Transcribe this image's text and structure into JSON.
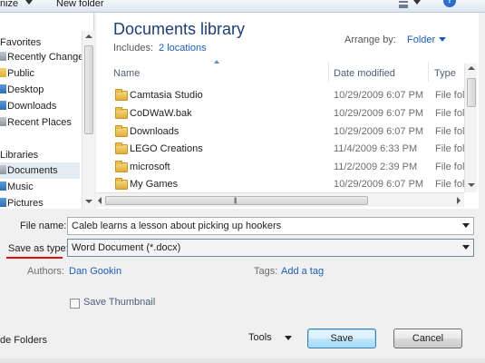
{
  "toolbar": {
    "organize_label": "nize",
    "new_folder_label": "New folder"
  },
  "nav": {
    "favorites_heading": "Favorites",
    "favorites": [
      {
        "label": "Recently Changed",
        "icon": "recent-places-icon"
      },
      {
        "label": "Public",
        "icon": "folder-icon"
      },
      {
        "label": "Desktop",
        "icon": "desktop-icon"
      },
      {
        "label": "Downloads",
        "icon": "downloads-icon"
      },
      {
        "label": "Recent Places",
        "icon": "recent-places-icon"
      }
    ],
    "libraries_heading": "Libraries",
    "libraries": [
      {
        "label": "Documents",
        "icon": "documents-icon",
        "selected": true
      },
      {
        "label": "Music",
        "icon": "music-icon"
      },
      {
        "label": "Pictures",
        "icon": "pictures-icon"
      }
    ]
  },
  "library": {
    "title": "Documents library",
    "includes_label": "Includes:",
    "includes_link": "2 locations",
    "arrange_label": "Arrange by:",
    "arrange_value": "Folder"
  },
  "columns": {
    "name": "Name",
    "date_modified": "Date modified",
    "type": "Type"
  },
  "files": [
    {
      "name": "Camtasia Studio",
      "date": "10/29/2009 6:07 PM",
      "type": "File fol"
    },
    {
      "name": "CoDWaW.bak",
      "date": "10/29/2009 6:07 PM",
      "type": "File fol"
    },
    {
      "name": "Downloads",
      "date": "10/29/2009 6:07 PM",
      "type": "File fol"
    },
    {
      "name": "LEGO Creations",
      "date": "11/4/2009 6:33 PM",
      "type": "File fol"
    },
    {
      "name": "microsoft",
      "date": "11/2/2009 2:39 PM",
      "type": "File fol"
    },
    {
      "name": "My Games",
      "date": "10/29/2009 6:07 PM",
      "type": "File fol"
    }
  ],
  "form": {
    "file_name_label": "File name:",
    "file_name_value": "Caleb learns a lesson about picking up hookers",
    "save_as_type_label": "Save as type:",
    "save_as_type_value": "Word Document (*.docx)",
    "authors_label": "Authors:",
    "authors_value": "Dan Gookin",
    "tags_label": "Tags:",
    "tags_value": "Add a tag",
    "save_thumbnail_label": "Save Thumbnail"
  },
  "footer": {
    "hide_folders_label": "de Folders",
    "tools_label": "Tools",
    "save_label": "Save",
    "cancel_label": "Cancel"
  },
  "colors": {
    "accent": "#1d5fb4",
    "title": "#1e3f74",
    "annotation_underline": "#e10e0e"
  }
}
